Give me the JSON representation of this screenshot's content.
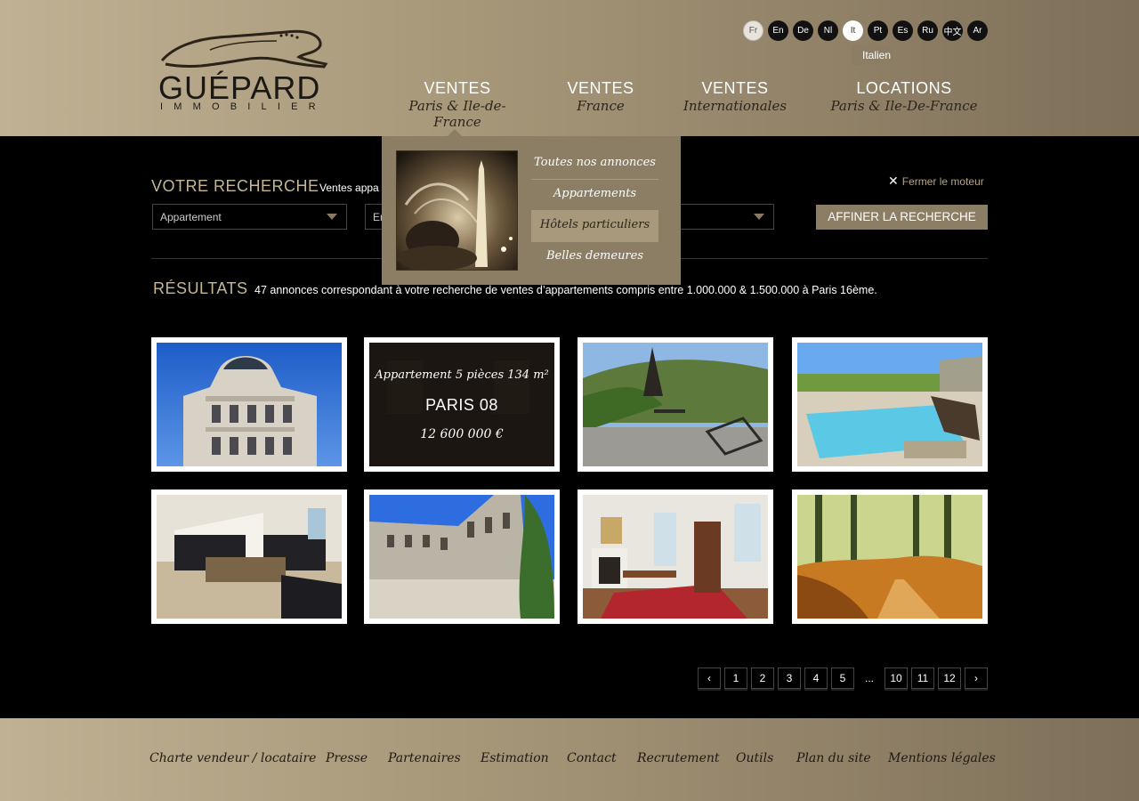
{
  "logo": {
    "word": "GUÉPARD",
    "sub": "IMMOBILIER"
  },
  "languages": [
    "Fr",
    "En",
    "De",
    "Nl",
    "It",
    "Pt",
    "Es",
    "Ru",
    "中文",
    "Ar"
  ],
  "language_tooltip": "Italien",
  "nav": [
    {
      "main": "VENTES",
      "sub": "Paris & Ile-de-France"
    },
    {
      "main": "VENTES",
      "sub": "France"
    },
    {
      "main": "VENTES",
      "sub": "Internationales"
    },
    {
      "main": "LOCATIONS",
      "sub": "Paris & Ile-De-France"
    }
  ],
  "dropdown": {
    "items": [
      "Toutes nos annonces",
      "Appartements",
      "Hôtels particuliers",
      "Belles demeures"
    ]
  },
  "search": {
    "title": "VOTRE RECHERCHE",
    "desc": "Ventes appa",
    "select1": "Appartement",
    "select2": "En",
    "close_label": "Fermer le moteur",
    "refine_label": "AFFINER LA RECHERCHE"
  },
  "results": {
    "title": "RÉSULTATS",
    "desc": "47 annonces correspondant à votre recherche de ventes d’appartements compris entre 1.000.000 & 1.500.000 à Paris 16ème."
  },
  "featured": {
    "type": "Appartement 5 pièces 134 m²",
    "city": "PARIS 08",
    "price": "12 600 000 €"
  },
  "pagination": [
    "1",
    "2",
    "3",
    "4",
    "5",
    "...",
    "10",
    "11",
    "12"
  ],
  "footer": [
    "Charte vendeur / locataire",
    "Presse",
    "Partenaires",
    "Estimation",
    "Contact",
    "Recrutement",
    "Outils",
    "Plan du site",
    "Mentions légales"
  ]
}
